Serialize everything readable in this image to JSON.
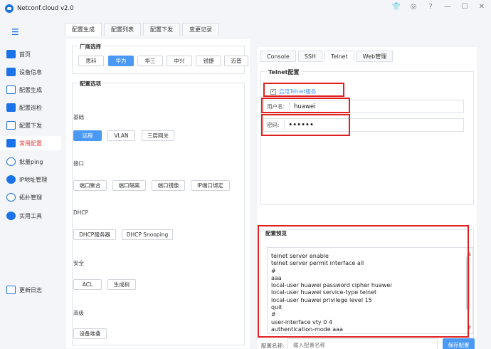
{
  "app": {
    "title": "Netconf.cloud v2.0"
  },
  "sidebar": {
    "items": [
      {
        "label": "首页"
      },
      {
        "label": "设备信息"
      },
      {
        "label": "配置生成"
      },
      {
        "label": "配置巡检"
      },
      {
        "label": "配置下发"
      },
      {
        "label": "常用配置"
      },
      {
        "label": "批量ping"
      },
      {
        "label": "IP地址管理"
      },
      {
        "label": "拓扑管理"
      },
      {
        "label": "实用工具"
      },
      {
        "label": "更新日志"
      }
    ]
  },
  "top_tabs": [
    "配置生成",
    "配置列表",
    "配置下发",
    "变更记录"
  ],
  "vendor": {
    "title": "厂商选择",
    "options": [
      "思科",
      "华为",
      "华三",
      "中兴",
      "锐捷",
      "迈普"
    ],
    "selected": "华为"
  },
  "config_options": {
    "title": "配置选项",
    "sections": [
      {
        "label": "基础",
        "buttons": [
          "远程",
          "VLAN",
          "三层网关"
        ]
      },
      {
        "label": "接口",
        "buttons": [
          "端口聚合",
          "端口隔离",
          "端口镜像",
          "IP端口绑定"
        ]
      },
      {
        "label": "DHCP",
        "buttons": [
          "DHCP服务器",
          "DHCP Snooping"
        ]
      },
      {
        "label": "安全",
        "buttons": [
          "ACL",
          "生成树"
        ]
      },
      {
        "label": "高级",
        "buttons": [
          "设备堆叠"
        ]
      }
    ]
  },
  "right_tabs": [
    "Console",
    "SSH",
    "Telnet",
    "Web管理"
  ],
  "telnet": {
    "title": "Telnet配置",
    "enable_label": "启用Telnet服务",
    "username_label": "用户名:",
    "username_value": "huawei",
    "password_label": "密码:",
    "password_value": "••••••"
  },
  "preview": {
    "title": "配置预览",
    "lines": "telnet server enable\ntelnet server permit interface all\n#\naaa\nlocal-user huawei password cipher huawei\nlocal-user huawei service-type telnet\nlocal-user huawei privilege level 15\nquit\n#\nuser-interface vty 0 4\nauthentication-mode aaa"
  },
  "footer": {
    "name_label": "配置名称:",
    "name_placeholder": "输入配置名称",
    "save_label": "保存配置"
  },
  "colors": {
    "accent": "#4a9af5",
    "highlight": "#e02020",
    "active_nav": "#e23c3c"
  }
}
